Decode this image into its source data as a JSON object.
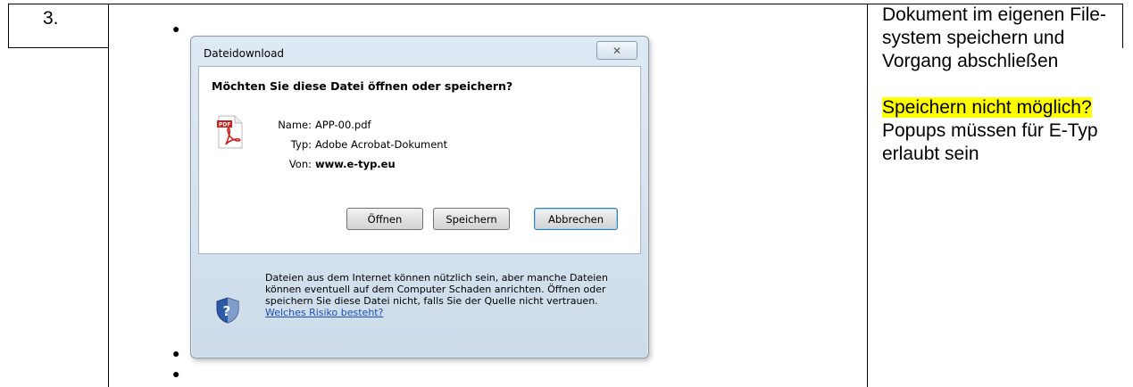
{
  "row_number": "3.",
  "dialog": {
    "title": "Dateidownload",
    "close_label": "✕",
    "question": "Möchten Sie diese Datei öffnen oder speichern?",
    "file_icon": "pdf-file-icon",
    "fields": [
      {
        "key": "Name:",
        "value": "APP-00.pdf"
      },
      {
        "key": "Typ:",
        "value": "Adobe Acrobat-Dokument"
      },
      {
        "key": "Von:",
        "value": "www.e-typ.eu"
      }
    ],
    "buttons": {
      "open": "Öffnen",
      "save": "Speichern",
      "cancel": "Abbrechen"
    },
    "warning": {
      "icon": "shield-question-icon",
      "text": "Dateien aus dem Internet können nützlich sein, aber manche Dateien können eventuell auf dem Computer Schaden anrichten. Öffnen oder speichern Sie diese Datei nicht, falls Sie der Quelle nicht vertrauen. ",
      "link": "Welches Risiko besteht?"
    }
  },
  "instructions": {
    "step_text": "Dokument im eigenen File-system speichern und Vorgang abschließen",
    "highlight": "Speichern nicht möglich?",
    "note": "Popups müssen für E-Typ erlaubt sein"
  },
  "colors": {
    "highlight": "#ffff00",
    "link": "#1a4fb5",
    "pdf_red": "#c9201c"
  }
}
